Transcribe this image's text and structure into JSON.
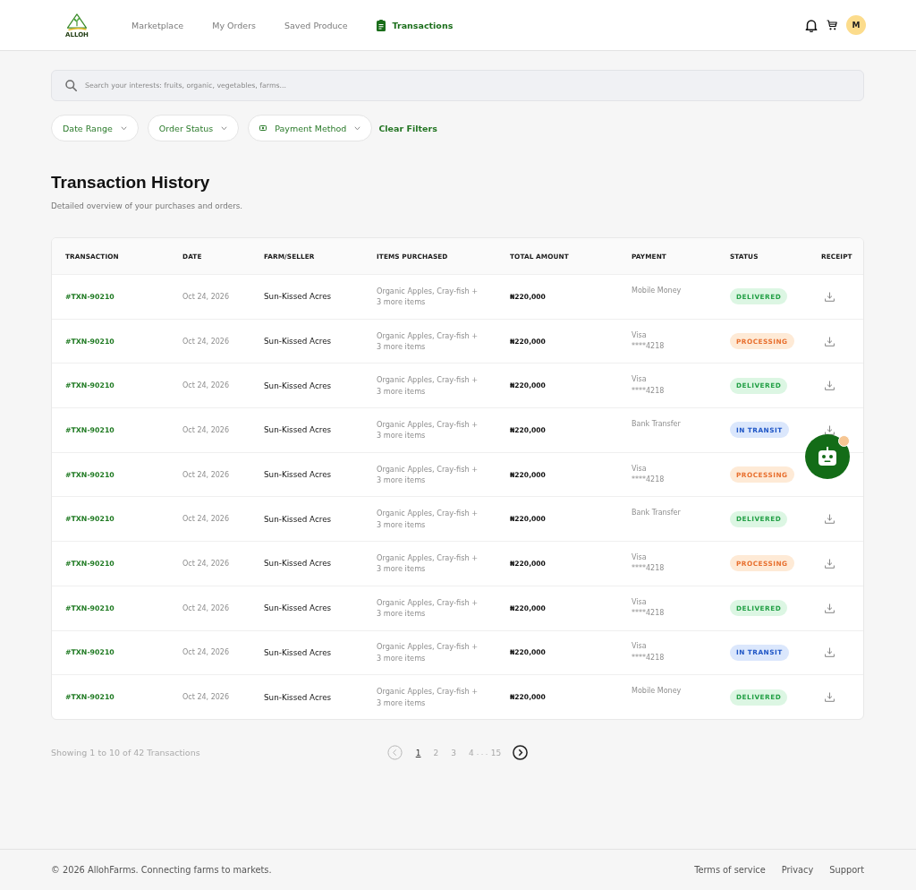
{
  "header": {
    "logo_text": "ALLOH",
    "nav": [
      {
        "label": "Marketplace",
        "selected": false
      },
      {
        "label": "My Orders",
        "selected": false
      },
      {
        "label": "Saved Produce",
        "selected": false
      },
      {
        "label": "Transactions",
        "selected": true
      }
    ],
    "avatar_initial": "M"
  },
  "search": {
    "placeholder": "Search your interests: fruits, organic, vegetables, farms..."
  },
  "filters": [
    {
      "label": "Date Range",
      "kind": "plain"
    },
    {
      "label": "Order Status",
      "kind": "plain"
    },
    {
      "label": "Payment Method",
      "kind": "with_icon"
    }
  ],
  "clear_filters": "Clear Filters",
  "page_title": "Transaction History",
  "page_subtitle": "Detailed overview of your purchases and orders.",
  "table": {
    "columns": [
      "TRANSACTION",
      "DATE",
      "FARM/SELLER",
      "ITEMS PURCHASED",
      "TOTAL AMOUNT",
      "PAYMENT",
      "STATUS",
      "RECEIPT"
    ],
    "rows": [
      {
        "transaction": "#TXN-90210",
        "date": "Oct 24, 2026",
        "seller": "Sun-Kissed Acres",
        "items": "Organic Apples, Cray-fish + 3 more items",
        "total": "₦220,000",
        "payment": {
          "method": "Mobile Money"
        },
        "status": {
          "label": "DELIVERED",
          "kind": "delivered"
        },
        "has_receipt": true
      },
      {
        "transaction": "#TXN-90210",
        "date": "Oct 24, 2026",
        "seller": "Sun-Kissed Acres",
        "items": "Organic Apples, Cray-fish + 3 more items",
        "total": "₦220,000",
        "payment": {
          "method": "Visa",
          "card": "****4218"
        },
        "status": {
          "label": "PROCESSING",
          "kind": "processing"
        },
        "has_receipt": true
      },
      {
        "transaction": "#TXN-90210",
        "date": "Oct 24, 2026",
        "seller": "Sun-Kissed Acres",
        "items": "Organic Apples, Cray-fish + 3 more items",
        "total": "₦220,000",
        "payment": {
          "method": "Visa",
          "card": "****4218"
        },
        "status": {
          "label": "DELIVERED",
          "kind": "delivered"
        },
        "has_receipt": true
      },
      {
        "transaction": "#TXN-90210",
        "date": "Oct 24, 2026",
        "seller": "Sun-Kissed Acres",
        "items": "Organic Apples, Cray-fish + 3 more items",
        "total": "₦220,000",
        "payment": {
          "method": "Bank Transfer"
        },
        "status": {
          "label": "IN TRANSIT",
          "kind": "in_transit"
        },
        "has_receipt": true
      },
      {
        "transaction": "#TXN-90210",
        "date": "Oct 24, 2026",
        "seller": "Sun-Kissed Acres",
        "items": "Organic Apples, Cray-fish + 3 more items",
        "total": "₦220,000",
        "payment": {
          "method": "Visa",
          "card": "****4218"
        },
        "status": {
          "label": "PROCESSING",
          "kind": "processing"
        },
        "has_receipt": false
      },
      {
        "transaction": "#TXN-90210",
        "date": "Oct 24, 2026",
        "seller": "Sun-Kissed Acres",
        "items": "Organic Apples, Cray-fish + 3 more items",
        "total": "₦220,000",
        "payment": {
          "method": "Bank Transfer"
        },
        "status": {
          "label": "DELIVERED",
          "kind": "delivered"
        },
        "has_receipt": true
      },
      {
        "transaction": "#TXN-90210",
        "date": "Oct 24, 2026",
        "seller": "Sun-Kissed Acres",
        "items": "Organic Apples, Cray-fish + 3 more items",
        "total": "₦220,000",
        "payment": {
          "method": "Visa",
          "card": "****4218"
        },
        "status": {
          "label": "PROCESSING",
          "kind": "processing"
        },
        "has_receipt": true
      },
      {
        "transaction": "#TXN-90210",
        "date": "Oct 24, 2026",
        "seller": "Sun-Kissed Acres",
        "items": "Organic Apples, Cray-fish + 3 more items",
        "total": "₦220,000",
        "payment": {
          "method": "Visa",
          "card": "****4218"
        },
        "status": {
          "label": "DELIVERED",
          "kind": "delivered"
        },
        "has_receipt": true
      },
      {
        "transaction": "#TXN-90210",
        "date": "Oct 24, 2026",
        "seller": "Sun-Kissed Acres",
        "items": "Organic Apples, Cray-fish + 3 more items",
        "total": "₦220,000",
        "payment": {
          "method": "Visa",
          "card": "****4218"
        },
        "status": {
          "label": "IN TRANSIT",
          "kind": "in_transit"
        },
        "has_receipt": true
      },
      {
        "transaction": "#TXN-90210",
        "date": "Oct 24, 2026",
        "seller": "Sun-Kissed Acres",
        "items": "Organic Apples, Cray-fish + 3 more items",
        "total": "₦220,000",
        "payment": {
          "method": "Mobile Money"
        },
        "status": {
          "label": "DELIVERED",
          "kind": "delivered"
        },
        "has_receipt": true
      }
    ]
  },
  "pagination": {
    "summary": "Showing 1 to 10 of 42 Transactions",
    "prev": {
      "disabled": true
    },
    "pages": [
      {
        "label": "1",
        "selected": true
      },
      {
        "label": "2",
        "selected": false
      },
      {
        "label": "3",
        "selected": false
      },
      {
        "label": "4",
        "selected": false
      },
      {
        "label": "15",
        "selected": false
      }
    ],
    "ellipsis": "...",
    "next": {
      "disabled": false
    }
  },
  "chat_assistant": {
    "has_notification": true
  },
  "footer": {
    "copyright": "© 2026 AllohFarms. Connecting farms to markets.",
    "links": [
      "Terms of service",
      "Privacy",
      "Support"
    ]
  }
}
